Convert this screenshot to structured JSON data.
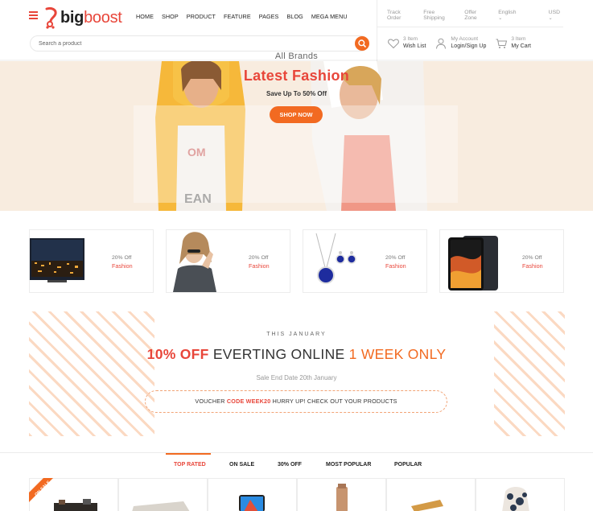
{
  "brand": {
    "name_a": "big",
    "name_b": "boost"
  },
  "nav": [
    "HOME",
    "SHOP",
    "PRODUCT",
    "FEATURE",
    "PAGES",
    "BLOG",
    "MEGA MENU"
  ],
  "topbar": {
    "track_order": "Track Order",
    "free_shipping": "Free Shipping",
    "offer_zone": "Offer Zone",
    "language": "English",
    "currency": "USD"
  },
  "search": {
    "placeholder": "Search a product",
    "value": ""
  },
  "tools": {
    "wishlist": {
      "line1": "3 Item",
      "line2": "Wish List"
    },
    "account": {
      "line1": "My Account",
      "line2": "Login/Sign Up"
    },
    "cart": {
      "line1": "3 Item",
      "line2": "My Cart"
    }
  },
  "hero": {
    "subtitle": "All Brands",
    "title": "Latest Fashion",
    "offer": "Save Up To 50% Off",
    "button": "SHOP NOW"
  },
  "categories": [
    {
      "discount": "20% Off",
      "label": "Fashion"
    },
    {
      "discount": "20% Off",
      "label": "Fashion"
    },
    {
      "discount": "20% Off",
      "label": "Fashion"
    },
    {
      "discount": "20% Off",
      "label": "Fashion"
    }
  ],
  "promo": {
    "eyebrow": "THIS JANUARY",
    "title_red": "10% OFF",
    "title_dark": "EVERTING ONLINE",
    "title_orange": "1 WEEK ONLY",
    "date": "Sale End Date 20th January",
    "voucher_pre": "VOUCHER",
    "voucher_code": "CODE WEEK20",
    "voucher_post": "HURRY UP! CHECK OUT YOUR PRODUCTS"
  },
  "tabs": [
    "TOP RATED",
    "ON SALE",
    "30% OFF",
    "MOST POPULAR",
    "POPULAR"
  ],
  "badge": "ON SALE",
  "colors": {
    "accent": "#e8463a",
    "orange": "#f26a21",
    "hero_bg": "#f8ecdf"
  }
}
